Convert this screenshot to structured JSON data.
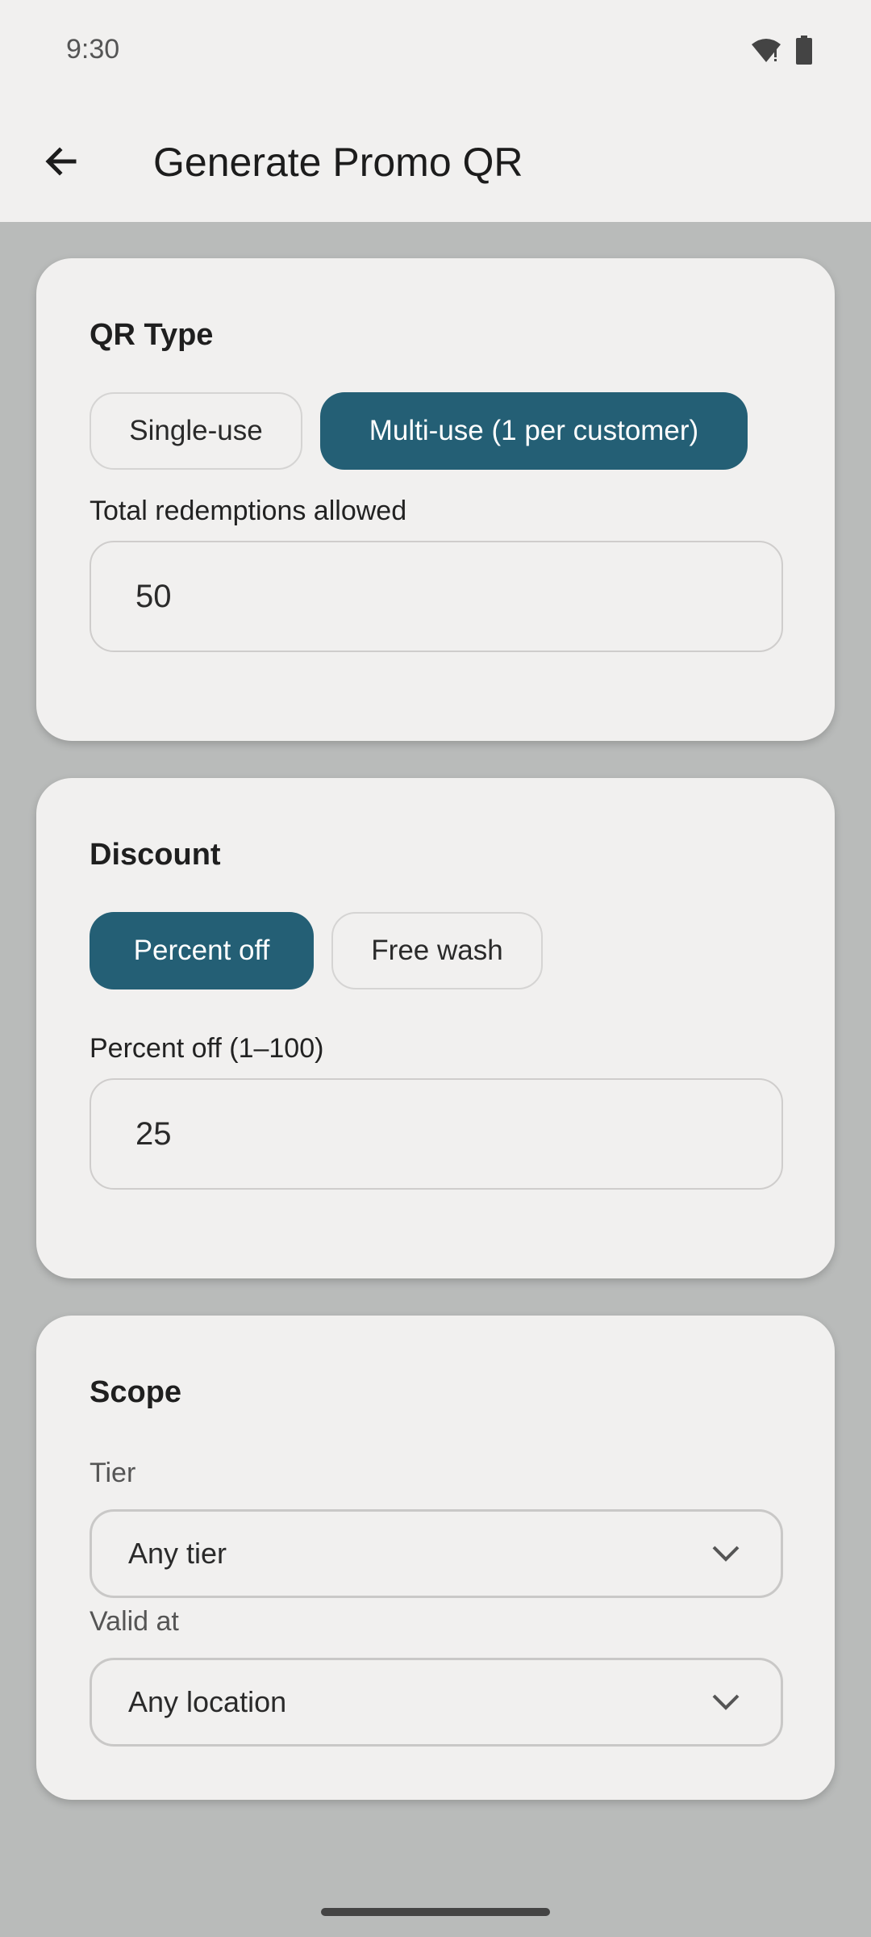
{
  "status_bar": {
    "time": "9:30",
    "icons": [
      "wifi-icon",
      "battery-icon"
    ]
  },
  "app_bar": {
    "title": "Generate Promo QR",
    "back_icon": "arrow-left-icon"
  },
  "qr_type": {
    "title": "QR Type",
    "options": [
      {
        "label": "Single-use",
        "selected": false
      },
      {
        "label": "Multi-use (1 per customer)",
        "selected": true
      }
    ],
    "redemptions_label": "Total redemptions allowed",
    "redemptions_value": "50"
  },
  "discount": {
    "title": "Discount",
    "options": [
      {
        "label": "Percent off",
        "selected": true
      },
      {
        "label": "Free wash",
        "selected": false
      }
    ],
    "percent_label": "Percent off (1–100)",
    "percent_value": "25"
  },
  "scope": {
    "title": "Scope",
    "tier_label": "Tier",
    "tier_value": "Any tier",
    "valid_label": "Valid at",
    "valid_value": "Any location"
  },
  "colors": {
    "accent": "#245f75",
    "surface": "#f1f0ef",
    "background": "#b9bbba"
  }
}
